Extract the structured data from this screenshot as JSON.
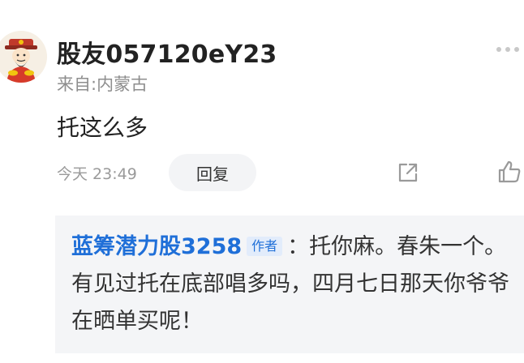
{
  "comment": {
    "username": "股友057120eY23",
    "location": "来自:内蒙古",
    "text": "托这么多",
    "time": "今天 23:49",
    "reply_label": "回复"
  },
  "quoted_reply": {
    "username": "蓝筹潜力股3258",
    "author_tag": "作者",
    "text": "：托你麻。春朱一个。有见过托在底部唱多吗，四月七日那天你爷爷在晒单买呢！"
  },
  "icons": {
    "avatar": "god-of-wealth-avatar",
    "more": "more-dots-icon",
    "share": "share-icon",
    "like": "thumbs-up-icon"
  },
  "colors": {
    "link_blue": "#1f6fd8",
    "quote_bg": "#f4f5f7",
    "muted": "#9a9a9a"
  }
}
